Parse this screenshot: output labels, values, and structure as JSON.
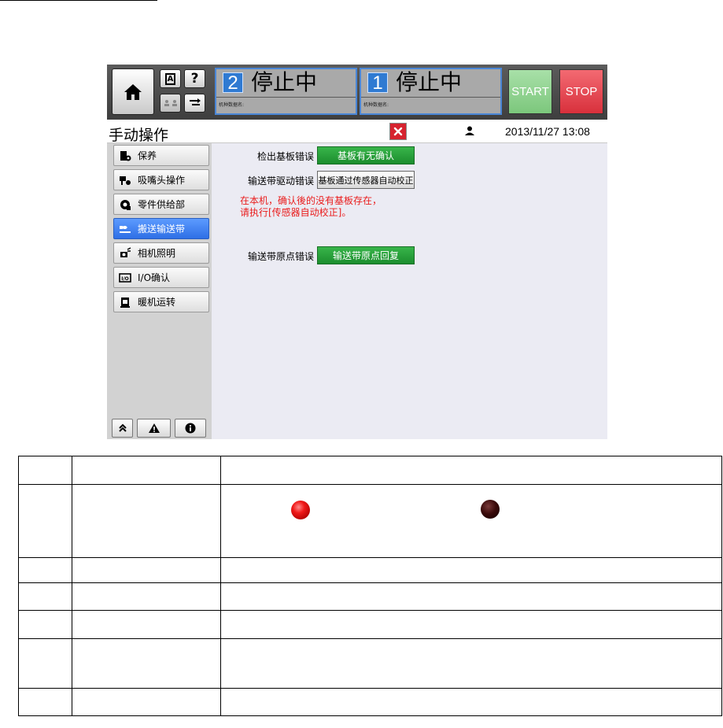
{
  "header": {
    "window_a_num": "2",
    "window_a_status": "停止中",
    "window_a_sub": "机种数据名:",
    "window_b_num": "1",
    "window_b_status": "停止中",
    "window_b_sub": "机种数据名:",
    "start_label": "START",
    "stop_label": "STOP",
    "question_label": "?",
    "a_label": "A"
  },
  "titlebar": {
    "title": "手动操作",
    "datetime": "2013/11/27 13:08"
  },
  "sidebar": {
    "items": [
      {
        "label": "保养",
        "icon": "maintenance-icon"
      },
      {
        "label": "吸嘴头操作",
        "icon": "nozzle-head-icon"
      },
      {
        "label": "零件供给部",
        "icon": "parts-feeder-icon"
      },
      {
        "label": "搬送输送带",
        "icon": "conveyor-icon",
        "active": true
      },
      {
        "label": "相机照明",
        "icon": "camera-light-icon"
      },
      {
        "label": "I/O确认",
        "icon": "io-icon"
      },
      {
        "label": "暖机运转",
        "icon": "warmup-icon"
      }
    ]
  },
  "content": {
    "row1_label": "检出基板错误",
    "row1_button": "基板有无确认",
    "row2_label": "输送带驱动错误",
    "row2_button": "基板通过传感器自动校正",
    "warning_line1": "在本机，确认後的没有基板存在，",
    "warning_line2": "请执行[传感器自动校正]。",
    "row3_label": "输送带原点错误",
    "row3_button": "输送带原点回复"
  },
  "legend_table": {
    "lamp_on_color": "#f01a1a",
    "lamp_off_color": "#3c0b0b"
  }
}
